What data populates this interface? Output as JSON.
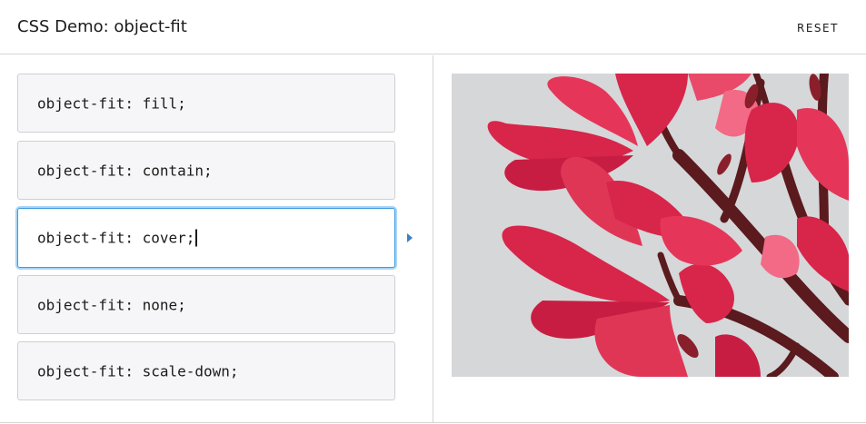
{
  "header": {
    "title": "CSS Demo: object-fit",
    "reset_label": "RESET"
  },
  "choices": [
    {
      "code": "object-fit: fill;",
      "selected": false
    },
    {
      "code": "object-fit: contain;",
      "selected": false
    },
    {
      "code": "object-fit: cover;",
      "selected": true
    },
    {
      "code": "object-fit: none;",
      "selected": false
    },
    {
      "code": "object-fit: scale-down;",
      "selected": false
    }
  ],
  "output": {
    "image_subject": "red frangipani flowers on branches",
    "colors": {
      "background": "#d6d7d9",
      "petal": "#d8254a",
      "petal_light": "#f26a86",
      "branch": "#5a1a1e"
    }
  },
  "accent_color": "#3b9ae0"
}
